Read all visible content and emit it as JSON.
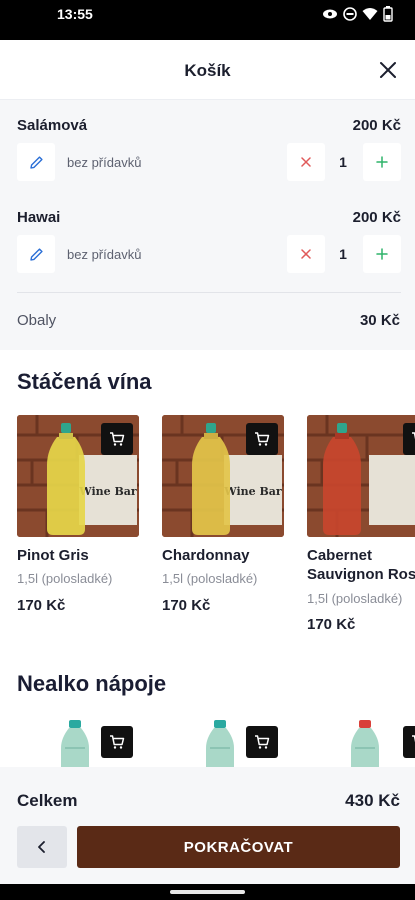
{
  "status_bar": {
    "time": "13:55",
    "icons": [
      "eye-icon",
      "dnd-icon",
      "wifi-icon",
      "battery-icon"
    ]
  },
  "header": {
    "title": "Košík",
    "close_icon": "close-icon"
  },
  "cart": {
    "items": [
      {
        "name": "Salámová",
        "price": "200 Kč",
        "note": "bez přídavků",
        "quantity": "1"
      },
      {
        "name": "Hawai",
        "price": "200 Kč",
        "note": "bez přídavků",
        "quantity": "1"
      }
    ],
    "packaging": {
      "label": "Obaly",
      "price": "30 Kč"
    }
  },
  "wines": {
    "title": "Stáčená vína",
    "products": [
      {
        "name": "Pinot Gris",
        "desc": "1,5l (polosladké)",
        "price": "170 Kč"
      },
      {
        "name": "Chardonnay",
        "desc": "1,5l (polosladké)",
        "price": "170 Kč"
      },
      {
        "name": "Cabernet Sauvignon Rosé",
        "desc": "1,5l (polosladké)",
        "price": "170 Kč"
      }
    ],
    "image_label": "Wine Bar"
  },
  "soft_drinks": {
    "title": "Nealko nápoje"
  },
  "footer": {
    "total_label": "Celkem",
    "total_value": "430 Kč",
    "continue_label": "POKRAČOVAT"
  },
  "colors": {
    "accent": "#5a2a16",
    "remove": "#e05a5a",
    "add": "#2fb36a",
    "edit": "#2b6fd6",
    "background": "#f6f7f9"
  }
}
